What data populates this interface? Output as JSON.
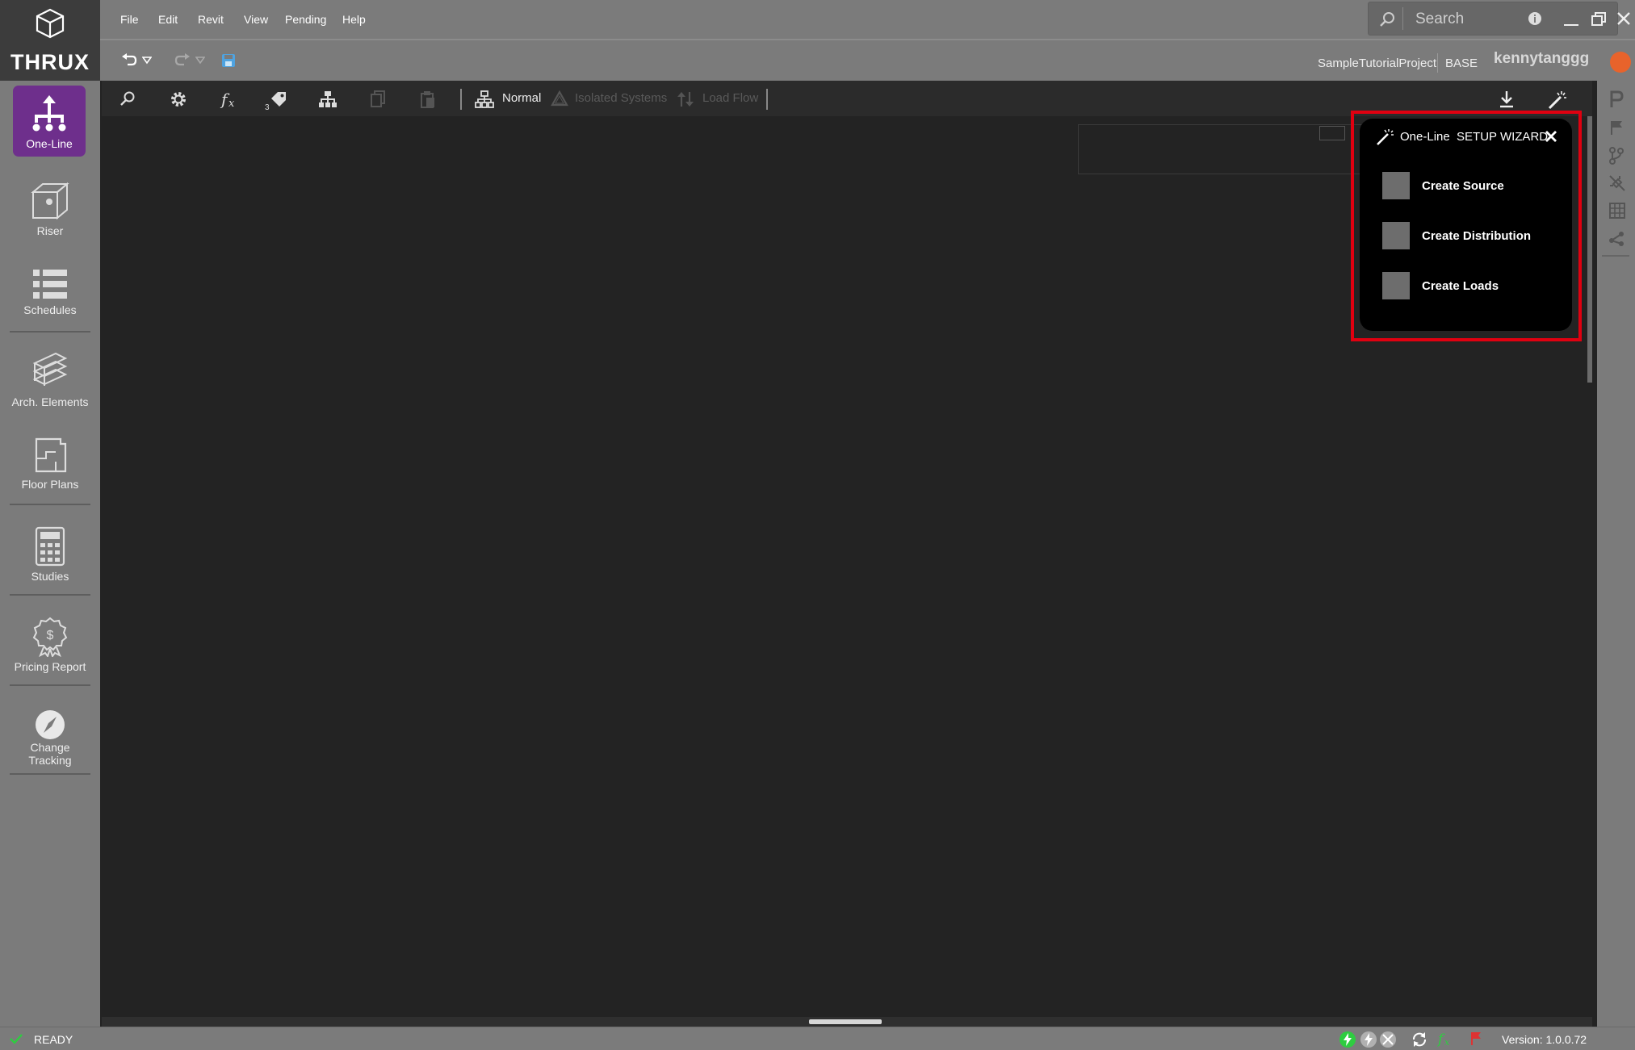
{
  "app": {
    "logo_text": "THRUX",
    "menu": [
      "File",
      "Edit",
      "Revit",
      "View",
      "Pending",
      "Help"
    ],
    "search_placeholder": "Search",
    "project": "SampleTutorialProject",
    "scenario": "BASE",
    "user": "kennytanggg"
  },
  "sidebar": {
    "items": [
      {
        "label": "One-Line"
      },
      {
        "label": "Riser"
      },
      {
        "label": "Schedules"
      },
      {
        "label": "Arch. Elements"
      },
      {
        "label": "Floor Plans"
      },
      {
        "label": "Studies"
      },
      {
        "label": "Pricing Report"
      },
      {
        "label": "Change Tracking"
      }
    ]
  },
  "toolbar": {
    "tag_count": "3",
    "view_modes": [
      "Normal",
      "Isolated Systems",
      "Load Flow"
    ]
  },
  "wizard": {
    "title": "One-Line  SETUP WIZARD",
    "steps": [
      {
        "label": "Create Source"
      },
      {
        "label": "Create Distribution"
      },
      {
        "label": "Create Loads"
      }
    ]
  },
  "status": {
    "state": "READY",
    "version_label": "Version:",
    "version": "1.0.0.72"
  },
  "colors": {
    "accent": "#6e2f8c",
    "highlight": "#e00010",
    "status_ok": "#2ecc40",
    "ui_gray": "#7b7b7b"
  }
}
